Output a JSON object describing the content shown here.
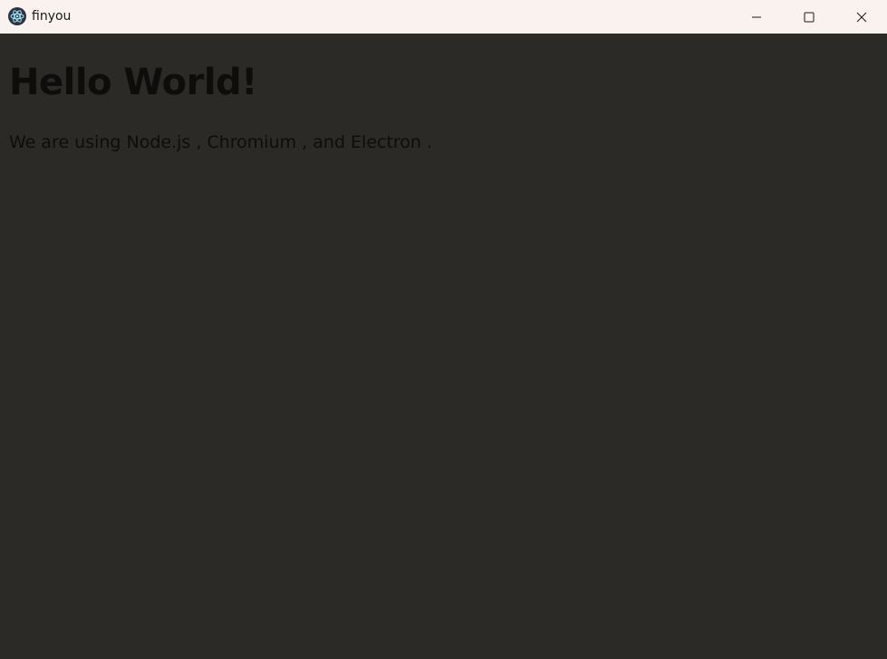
{
  "window": {
    "title": "finyou",
    "icon": "electron-atom-icon",
    "controls": {
      "minimize_icon": "minimize-icon",
      "maximize_icon": "maximize-icon",
      "close_icon": "close-icon"
    }
  },
  "page": {
    "heading": "Hello World!",
    "text_intro": "We are using Node.js",
    "sep1": " , ",
    "chromium": "Chromium",
    "sep2": " , and ",
    "electron": "Electron",
    "end": " ."
  },
  "colors": {
    "titlebar_bg": "#f9f2ef",
    "content_bg": "#2b2a27",
    "text": "#0e0d0c"
  }
}
